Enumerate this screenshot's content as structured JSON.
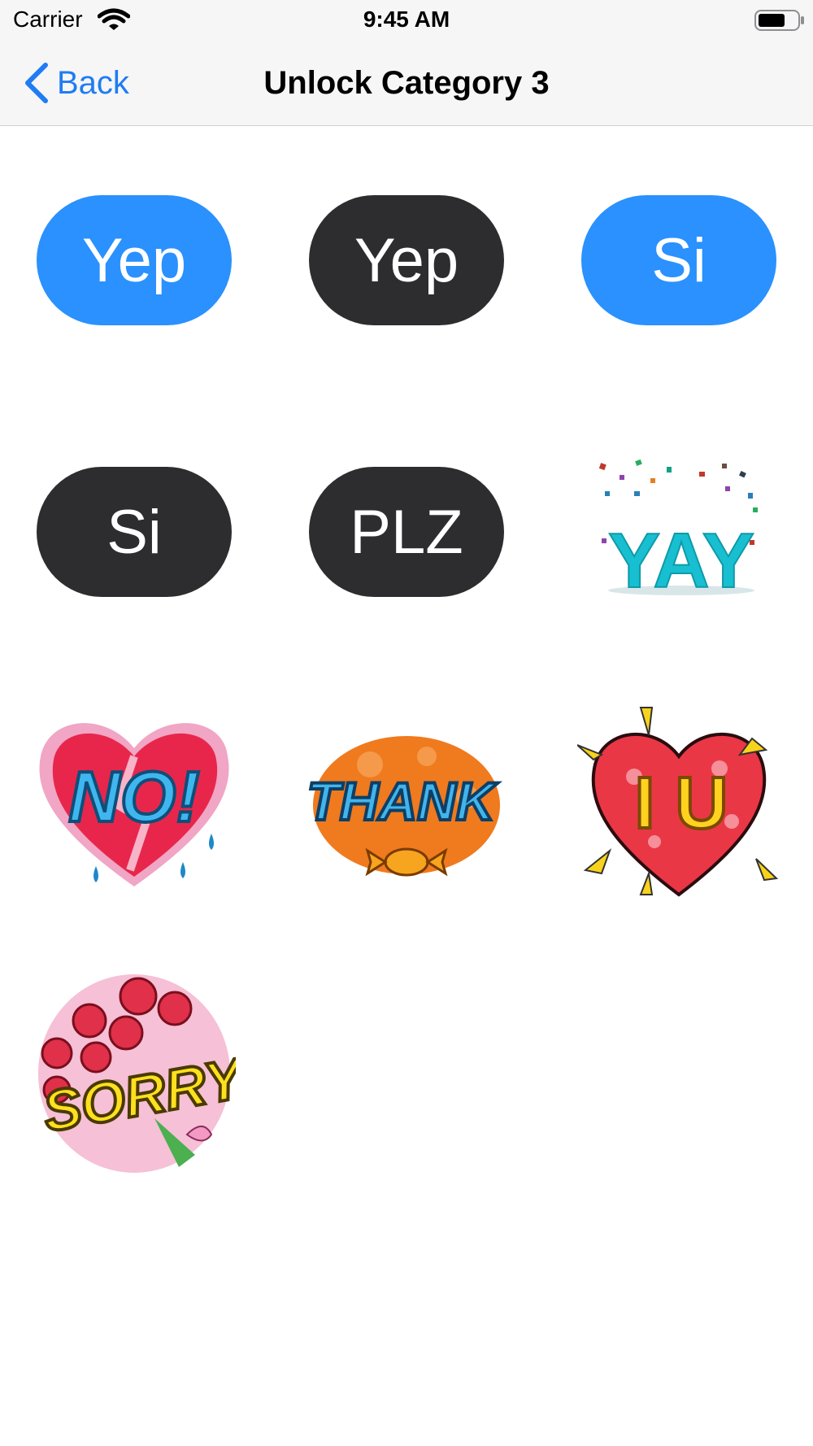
{
  "status_bar": {
    "carrier": "Carrier",
    "time": "9:45 AM"
  },
  "nav": {
    "back_label": "Back",
    "title": "Unlock Category 3"
  },
  "stickers": [
    {
      "text": "Yep",
      "style": "blue-bubble"
    },
    {
      "text": "Yep",
      "style": "dark-bubble"
    },
    {
      "text": "Si",
      "style": "blue-bubble"
    },
    {
      "text": "Si",
      "style": "dark-bubble"
    },
    {
      "text": "PLZ",
      "style": "dark-bubble"
    },
    {
      "text": "YAY",
      "style": "confetti-lettering"
    },
    {
      "text": "NO!",
      "style": "heart-lettering"
    },
    {
      "text": "THANK",
      "style": "candy-lettering"
    },
    {
      "text": "I U",
      "style": "heart-lettering"
    },
    {
      "text": "SORRY",
      "style": "roses-lettering"
    }
  ],
  "colors": {
    "accent": "#1f7cf4",
    "bubble_blue": "#2a91fe",
    "bubble_dark": "#2d2d2f"
  }
}
